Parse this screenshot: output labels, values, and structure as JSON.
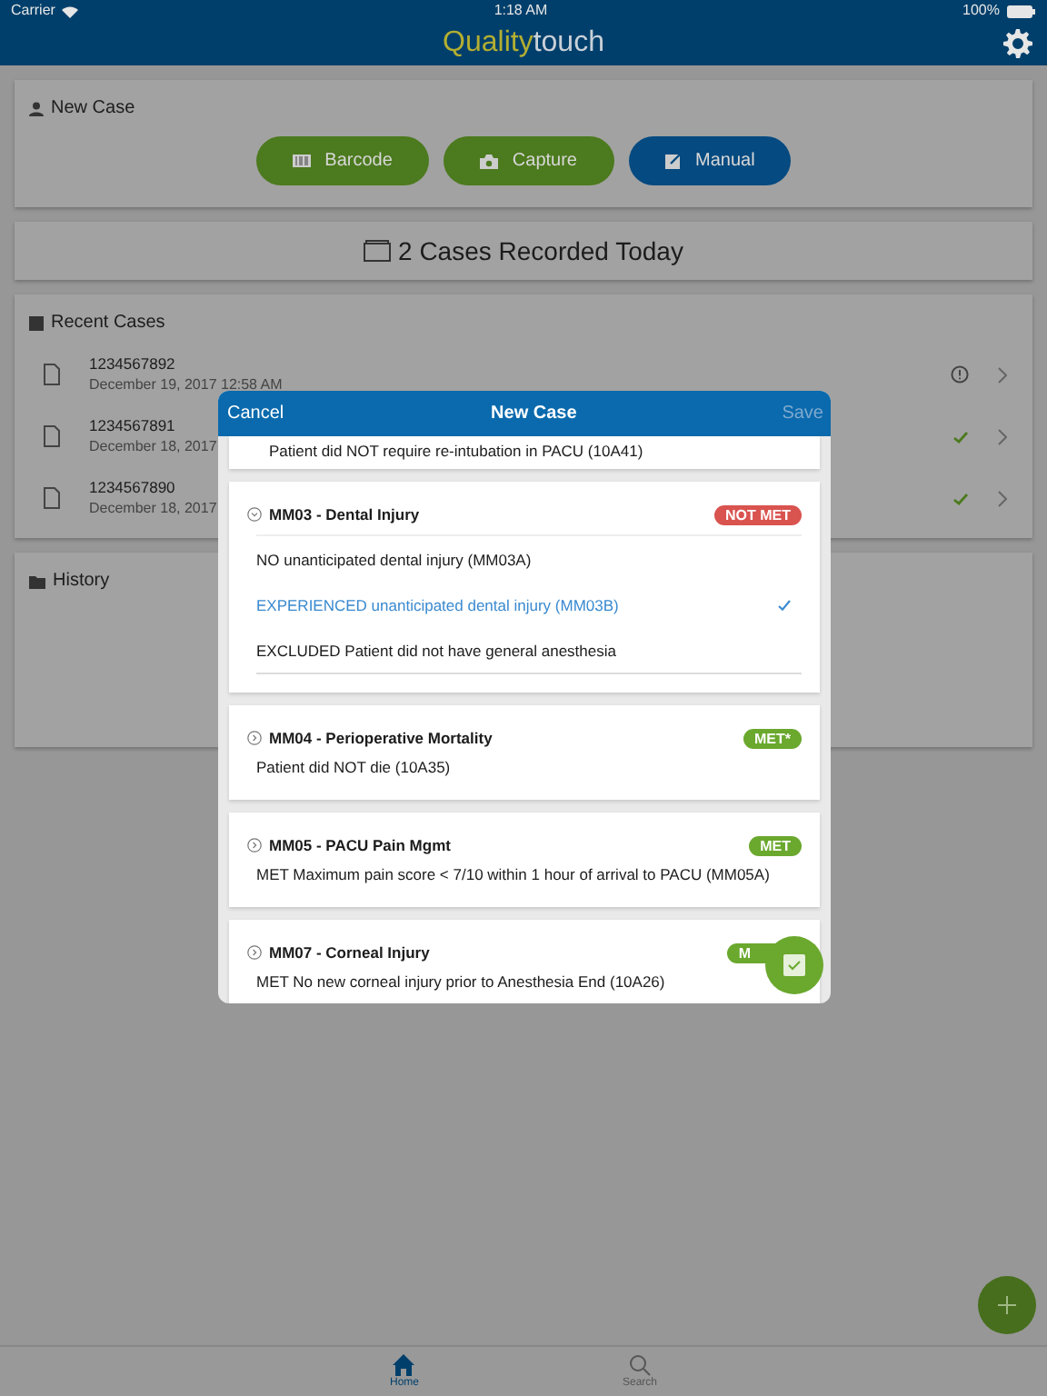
{
  "status_bar": {
    "carrier": "Carrier",
    "time": "1:18 AM",
    "battery": "100%"
  },
  "header": {
    "logo_left": "Quality",
    "logo_right": "touch"
  },
  "new_case": {
    "title": "New Case",
    "buttons": [
      {
        "label": "Barcode",
        "kind": "barcode",
        "selected": false
      },
      {
        "label": "Capture",
        "kind": "camera",
        "selected": false
      },
      {
        "label": "Manual",
        "kind": "manual",
        "selected": true
      }
    ]
  },
  "cases_today": "2 Cases Recorded Today",
  "recent_cases": {
    "title": "Recent Cases",
    "items": [
      {
        "number": "1234567892",
        "date": "December 19, 2017 12:58 AM",
        "flagged": true
      },
      {
        "number": "1234567891",
        "date": "December 18, 2017",
        "flagged": false
      },
      {
        "number": "1234567890",
        "date": "December 18, 2017",
        "flagged": false
      }
    ]
  },
  "history": {
    "title": "History"
  },
  "modal": {
    "cancel": "Cancel",
    "title": "New Case",
    "save": "Save",
    "save_disabled": true,
    "measures": [
      {
        "kind": "tail",
        "text": "Patient did NOT require re-intubation in PACU (10A41)"
      },
      {
        "kind": "measure",
        "title": "MM03 - Dental Injury",
        "expanded": true,
        "badge": "NOT MET",
        "color": "#d9534f",
        "options": [
          {
            "label": "NO unanticipated dental injury (MM03A)",
            "selected": false
          },
          {
            "label": "EXPERIENCED unanticipated dental injury (MM03B)",
            "selected": true
          },
          {
            "label": "EXCLUDED Patient did not have general anesthesia",
            "selected": false
          }
        ]
      },
      {
        "kind": "measure",
        "title": "MM04 - Perioperative Mortality",
        "expanded": false,
        "badge": "MET*",
        "color": "#6aa82e",
        "result": "Patient did NOT die (10A35)"
      },
      {
        "kind": "measure",
        "title": "MM05 - PACU Pain Mgmt",
        "expanded": false,
        "badge": "MET",
        "color": "#6aa82e",
        "result": "MET Maximum pain score < 7/10 within 1 hour of arrival to PACU (MM05A)"
      },
      {
        "kind": "measure",
        "title": "MM07 - Corneal Injury",
        "expanded": false,
        "badge": "M",
        "color": "#6aa82e",
        "result": "MET No new corneal injury prior to Anesthesia End (10A26)"
      }
    ]
  },
  "tabs": [
    {
      "label": "Home",
      "kind": "home",
      "selected": true
    },
    {
      "label": "Search",
      "kind": "search",
      "selected": false
    }
  ]
}
